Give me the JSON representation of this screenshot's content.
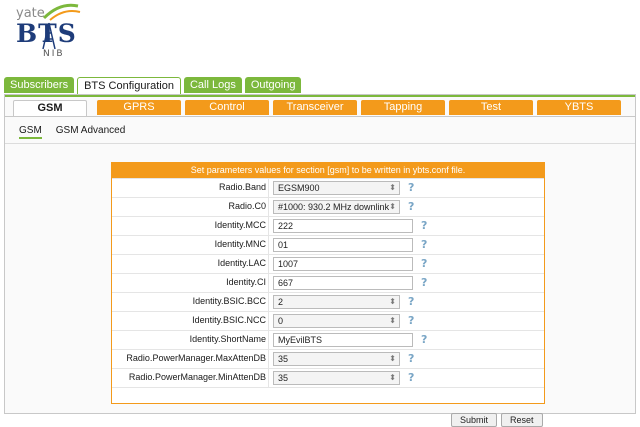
{
  "logo": {
    "yate": "yate",
    "bts": "BTS",
    "nib": "NIB"
  },
  "main_tabs": [
    {
      "label": "Subscribers",
      "active": false
    },
    {
      "label": "BTS Configuration",
      "active": true
    },
    {
      "label": "Call Logs",
      "active": false
    },
    {
      "label": "Outgoing",
      "active": false
    }
  ],
  "sub_tabs": [
    {
      "label": "GSM",
      "active": true
    },
    {
      "label": "GPRS"
    },
    {
      "label": "Control"
    },
    {
      "label": "Transceiver"
    },
    {
      "label": "Tapping"
    },
    {
      "label": "Test"
    },
    {
      "label": "YBTS"
    }
  ],
  "sections": [
    {
      "label": "GSM",
      "active": true
    },
    {
      "label": "GSM Advanced",
      "active": false
    }
  ],
  "form": {
    "header": "Set parameters values for section [gsm] to be written in ybts.conf file.",
    "help_icon": "?",
    "fields": [
      {
        "label": "Radio.Band",
        "type": "select",
        "value": "EGSM900"
      },
      {
        "label": "Radio.C0",
        "type": "select",
        "value": "#1000: 930.2 MHz downlink"
      },
      {
        "label": "Identity.MCC",
        "type": "input",
        "value": "222"
      },
      {
        "label": "Identity.MNC",
        "type": "input",
        "value": "01"
      },
      {
        "label": "Identity.LAC",
        "type": "input",
        "value": "1007"
      },
      {
        "label": "Identity.CI",
        "type": "input",
        "value": "667"
      },
      {
        "label": "Identity.BSIC.BCC",
        "type": "select",
        "value": "2"
      },
      {
        "label": "Identity.BSIC.NCC",
        "type": "select",
        "value": "0"
      },
      {
        "label": "Identity.ShortName",
        "type": "input",
        "value": "MyEvilBTS"
      },
      {
        "label": "Radio.PowerManager.MaxAttenDB",
        "type": "select",
        "value": "35"
      },
      {
        "label": "Radio.PowerManager.MinAttenDB",
        "type": "select",
        "value": "35"
      }
    ],
    "submit_label": "Submit",
    "reset_label": "Reset"
  },
  "colors": {
    "green": "#7cb83c",
    "orange": "#f39a1b",
    "help": "#7aa6c6"
  }
}
